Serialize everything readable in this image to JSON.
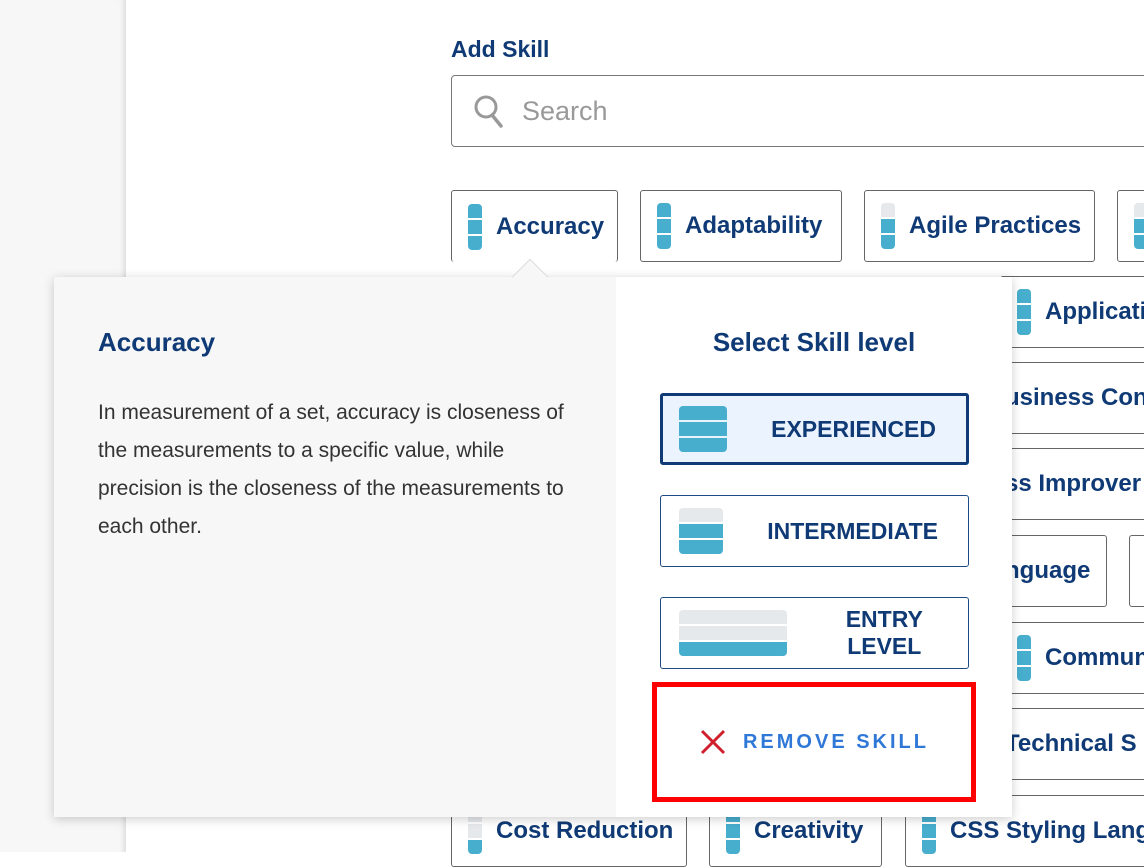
{
  "header": {
    "title": "Add Skill"
  },
  "search": {
    "placeholder": "Search",
    "value": "",
    "icon": "search-icon"
  },
  "colors": {
    "accent": "#0f3a75",
    "level_fill": "#47aecd",
    "level_empty": "#e6e9ec",
    "remove_text": "#2f78d8",
    "remove_icon": "#d0202e",
    "highlight": "#ff0000"
  },
  "skills": [
    {
      "label": "Accuracy",
      "level": 3
    },
    {
      "label": "Adaptability",
      "level": 3
    },
    {
      "label": "Agile Practices",
      "level": 2
    },
    {
      "label": "Applicati",
      "level": 3
    },
    {
      "label": "usiness Con",
      "level": 3
    },
    {
      "label": "ss Improver",
      "level": 3
    },
    {
      "label": "nguage",
      "level": 3
    },
    {
      "label": "Commun",
      "level": 3
    },
    {
      "label": "Technical S",
      "level": 3
    },
    {
      "label": "Cost Reduction",
      "level": 1
    },
    {
      "label": "Creativity",
      "level": 3
    },
    {
      "label": "CSS Styling Lang",
      "level": 3
    }
  ],
  "popover": {
    "skill_name": "Accuracy",
    "description": "In measurement of a set, accuracy is closeness of the measurements to a specific value, while precision is the closeness of the measurements to each other.",
    "level_heading": "Select Skill level",
    "levels": [
      {
        "label": "EXPERIENCED",
        "level": 3,
        "selected": true
      },
      {
        "label": "INTERMEDIATE",
        "level": 2,
        "selected": false
      },
      {
        "label": "ENTRY LEVEL",
        "level": 1,
        "selected": false
      }
    ],
    "remove_label": "REMOVE SKILL"
  }
}
